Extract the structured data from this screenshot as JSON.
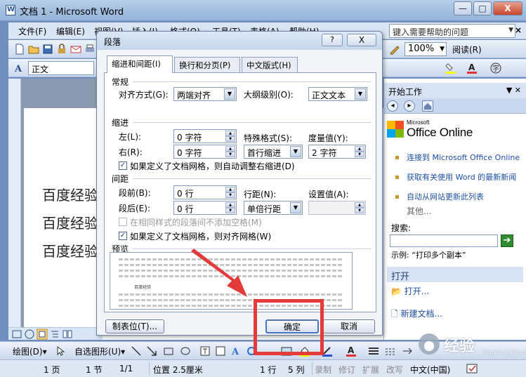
{
  "window": {
    "title": "文档 1 - Microsoft Word",
    "min_label": "—",
    "max_label": "□",
    "close_label": "X"
  },
  "menu": {
    "items": [
      "文件(F)",
      "编辑(E)",
      "视图(V)",
      "插入(I)",
      "格式(O)",
      "工具(T)",
      "表格(A)",
      "帮助(H)"
    ],
    "help_placeholder": "键入需要帮助的问题",
    "close_doc": "×"
  },
  "toolbar": {
    "zoom": "100%",
    "read_label": "阅读(R)",
    "style": "正文",
    "font": "宋"
  },
  "document": {
    "lines": [
      "百度经验",
      "百度经验",
      "百度经验"
    ]
  },
  "dialog": {
    "title": "段落",
    "help": "?",
    "close": "X",
    "tabs": [
      "缩进和间距(I)",
      "换行和分页(P)",
      "中文版式(H)"
    ],
    "general": {
      "heading": "常规",
      "alignment_label": "对齐方式(G):",
      "alignment_value": "两端对齐",
      "outline_label": "大纲级别(O):",
      "outline_value": "正文文本"
    },
    "indent": {
      "heading": "缩进",
      "left_label": "左(L):",
      "left_value": "0 字符",
      "right_label": "右(R):",
      "right_value": "0 字符",
      "special_label": "特殊格式(S):",
      "special_value": "首行缩进",
      "by_label": "度量值(Y):",
      "by_value": "2 字符",
      "grid_auto": "如果定义了文档网格，则自动调整右缩进(D)"
    },
    "spacing": {
      "heading": "间距",
      "before_label": "段前(B):",
      "before_value": "0 行",
      "after_label": "段后(E):",
      "after_value": "0 行",
      "line_label": "行距(N):",
      "line_value": "单倍行距",
      "at_label": "设置值(A):",
      "no_space_same_style": "在相同样式的段落间不添加空格(M)",
      "snap_grid": "如果定义了文档网格，则对齐网格(W)"
    },
    "preview": {
      "heading": "预览",
      "sample": "百度经验"
    },
    "buttons": {
      "tabs": "制表位(T)...",
      "ok": "确定",
      "cancel": "取消"
    }
  },
  "taskpane": {
    "title": "开始工作",
    "logo_small": "Microsoft",
    "logo_big": "Office Online",
    "links": [
      "连接到 Microsoft Office Online",
      "获取有关使用 Word 的最新新闻",
      "自动从网站更新此列表"
    ],
    "more": "其他...",
    "search_label": "搜索:",
    "example": "示例: “打印多个副本”",
    "open_heading": "打开",
    "open_link": "打开...",
    "new_doc": "新建文档..."
  },
  "drawbar": {
    "draw": "绘图(D)▾",
    "autoshapes": "自选图形(U)▾"
  },
  "status": {
    "page": "1 页",
    "section": "1 节",
    "pages": "1/1",
    "position": "位置 2.5厘米",
    "line": "1 行",
    "col": "5 列",
    "rec": "录制",
    "trk": "修订",
    "ext": "扩展",
    "ovr": "改写",
    "lang": "中文(中国)"
  },
  "watermark": {
    "text": "经验",
    "sub": "jingyan.baidu.com"
  },
  "colors": {
    "annotation": "#e53a3a",
    "title_bar": "#a4c0df",
    "link": "#1b4fa8"
  }
}
